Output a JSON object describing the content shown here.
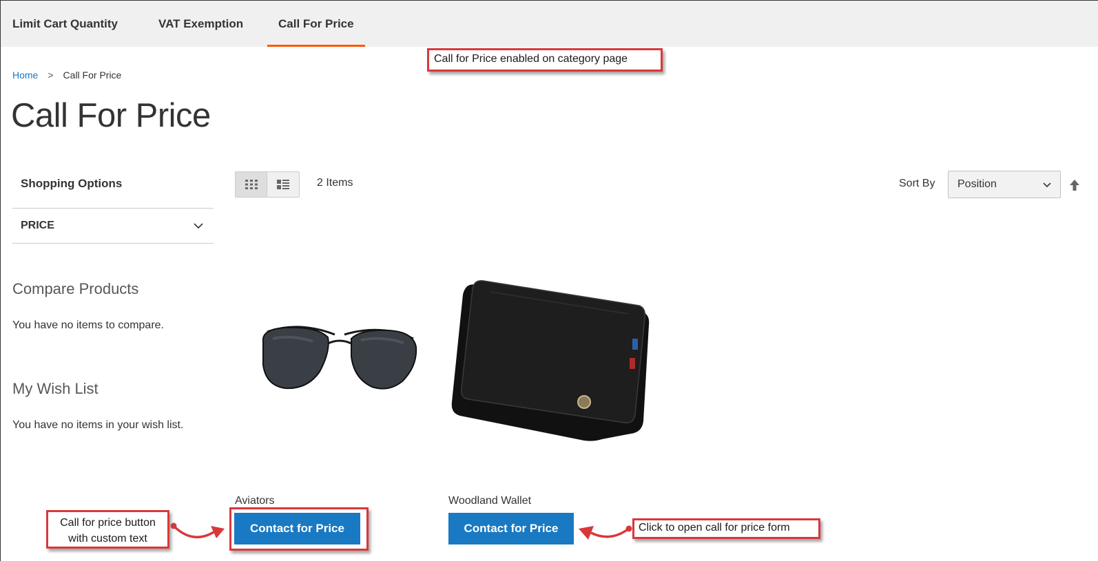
{
  "nav": {
    "items": [
      {
        "label": "Limit Cart Quantity",
        "active": false
      },
      {
        "label": "VAT Exemption",
        "active": false
      },
      {
        "label": "Call For Price",
        "active": true
      }
    ],
    "accent": "#ff5501"
  },
  "breadcrumb": {
    "home": "Home",
    "separator": ">",
    "current": "Call For Price"
  },
  "page_title": "Call For Price",
  "sidebar": {
    "shopping_options": "Shopping Options",
    "filter_label": "PRICE",
    "compare_title": "Compare Products",
    "compare_text": "You have no items to compare.",
    "wishlist_title": "My Wish List",
    "wishlist_text": "You have no items in your wish list."
  },
  "toolbar": {
    "modes": [
      {
        "name": "grid",
        "icon": "grid-icon",
        "active": true
      },
      {
        "name": "list",
        "icon": "list-icon",
        "active": false
      }
    ],
    "amount": "2 Items",
    "sort_label": "Sort By",
    "sort_value": "Position",
    "sort_direction_icon": "arrow-up-icon"
  },
  "products": [
    {
      "name": "Aviators",
      "image_icon": "sunglasses-image",
      "button_label": "Contact for Price"
    },
    {
      "name": "Woodland Wallet",
      "image_icon": "wallet-image",
      "button_label": "Contact for Price"
    }
  ],
  "annotations": {
    "category": "Call for Price enabled on category page",
    "button_line1": "Call for price button",
    "button_line2": "with custom text",
    "form": "Click to open call for price form"
  },
  "colors": {
    "primary_button": "#1979c3",
    "link": "#1979c3",
    "annotation_border": "#d9383b"
  }
}
